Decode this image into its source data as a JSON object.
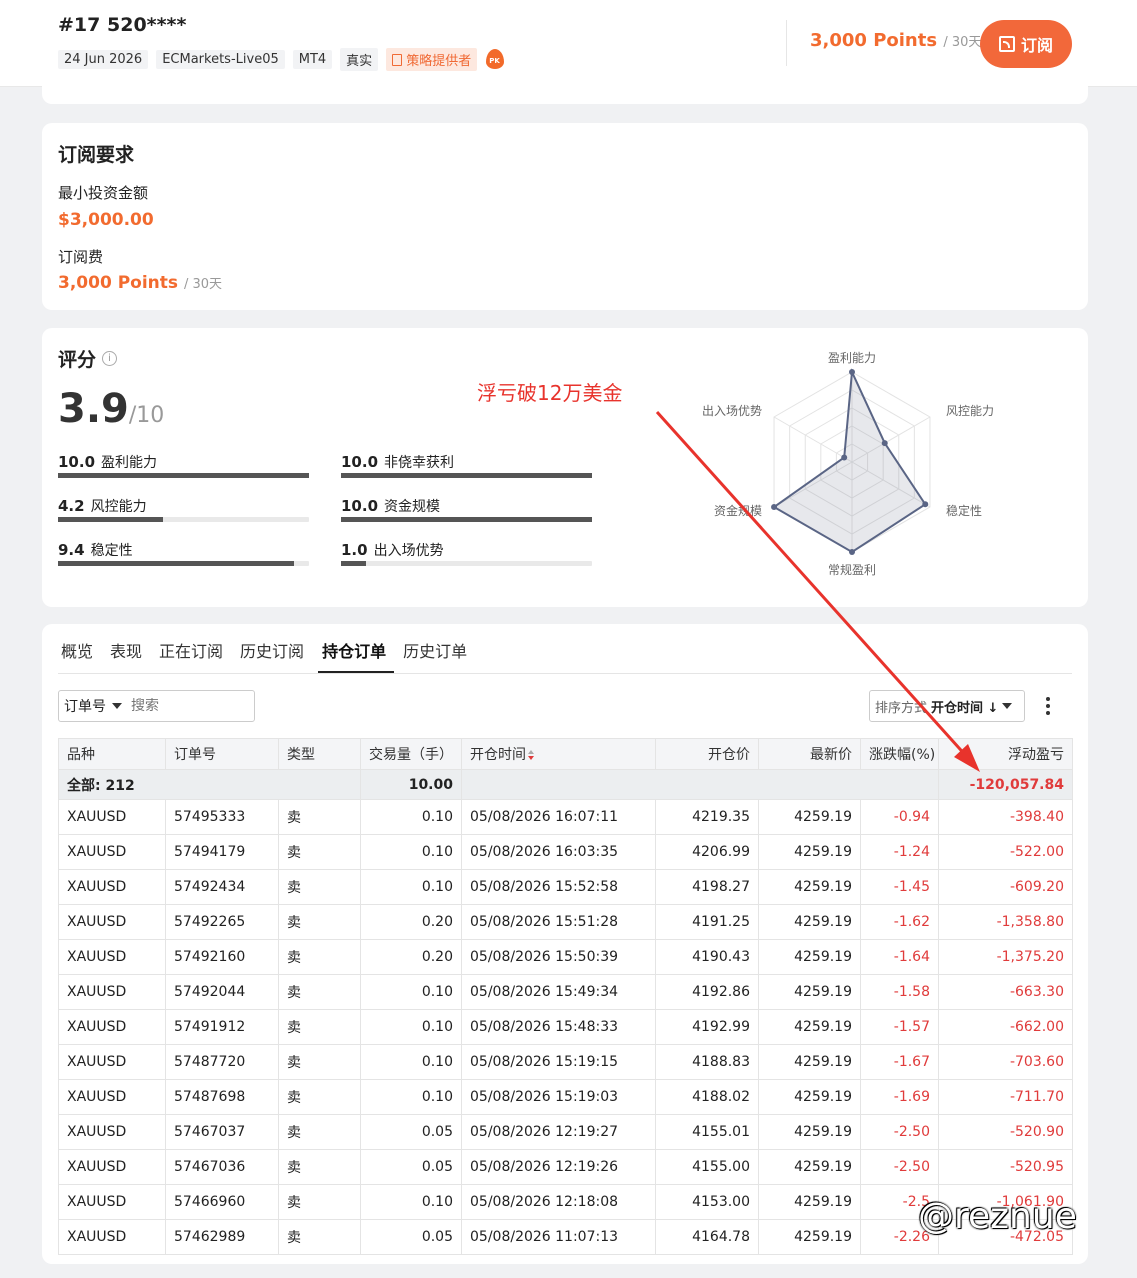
{
  "header": {
    "rank": "#17",
    "name": "520****",
    "tags": [
      "24 Jun 2026",
      "ECMarkets-Live05",
      "MT4",
      "真实"
    ],
    "provider_tag": "策略提供者",
    "pk_badge": "PK",
    "price": "3,000 Points",
    "price_period": "/ 30天",
    "subscribe_label": "订阅"
  },
  "requirements": {
    "title": "订阅要求",
    "min_invest_label": "最小投资金额",
    "min_invest_value": "$3,000.00",
    "fee_label": "订阅费",
    "fee_value": "3,000 Points",
    "fee_period": "/ 30天"
  },
  "score": {
    "title": "评分",
    "info_icon": "i",
    "value": "3.9",
    "max": "/10",
    "metrics": [
      {
        "value": "10.0",
        "label": "盈利能力",
        "fraction": 1.0
      },
      {
        "value": "10.0",
        "label": "非侥幸获利",
        "fraction": 1.0
      },
      {
        "value": "4.2",
        "label": "风控能力",
        "fraction": 0.42
      },
      {
        "value": "10.0",
        "label": "资金规模",
        "fraction": 1.0
      },
      {
        "value": "9.4",
        "label": "稳定性",
        "fraction": 0.94
      },
      {
        "value": "1.0",
        "label": "出入场优势",
        "fraction": 0.1
      }
    ],
    "radar_labels": [
      "盈利能力",
      "风控能力",
      "稳定性",
      "常规盈利",
      "资金规模",
      "出入场优势"
    ],
    "radar_values": [
      1.0,
      0.42,
      0.94,
      1.0,
      1.0,
      0.1
    ],
    "annotation": "浮亏破12万美金",
    "annotation_color": "#e8332c"
  },
  "tabs": [
    "概览",
    "表现",
    "正在订阅",
    "历史订阅",
    "持仓订单",
    "历史订单"
  ],
  "active_tab": "持仓订单",
  "filter": {
    "field": "订单号",
    "placeholder": "搜索"
  },
  "sort": {
    "label": "排序方式",
    "value": "开仓时间 ↓"
  },
  "table": {
    "headers": [
      "品种",
      "订单号",
      "类型",
      "交易量（手）",
      "开仓时间",
      "开仓价",
      "最新价",
      "涨跌幅(%)",
      "浮动盈亏"
    ],
    "total_label": "全部: 212",
    "total_volume": "10.00",
    "total_pnl": "-120,057.84",
    "rows": [
      [
        "XAUUSD",
        "57495333",
        "卖",
        "0.10",
        "05/08/2026 16:07:11",
        "4219.35",
        "4259.19",
        "-0.94",
        "-398.40"
      ],
      [
        "XAUUSD",
        "57494179",
        "卖",
        "0.10",
        "05/08/2026 16:03:35",
        "4206.99",
        "4259.19",
        "-1.24",
        "-522.00"
      ],
      [
        "XAUUSD",
        "57492434",
        "卖",
        "0.10",
        "05/08/2026 15:52:58",
        "4198.27",
        "4259.19",
        "-1.45",
        "-609.20"
      ],
      [
        "XAUUSD",
        "57492265",
        "卖",
        "0.20",
        "05/08/2026 15:51:28",
        "4191.25",
        "4259.19",
        "-1.62",
        "-1,358.80"
      ],
      [
        "XAUUSD",
        "57492160",
        "卖",
        "0.20",
        "05/08/2026 15:50:39",
        "4190.43",
        "4259.19",
        "-1.64",
        "-1,375.20"
      ],
      [
        "XAUUSD",
        "57492044",
        "卖",
        "0.10",
        "05/08/2026 15:49:34",
        "4192.86",
        "4259.19",
        "-1.58",
        "-663.30"
      ],
      [
        "XAUUSD",
        "57491912",
        "卖",
        "0.10",
        "05/08/2026 15:48:33",
        "4192.99",
        "4259.19",
        "-1.57",
        "-662.00"
      ],
      [
        "XAUUSD",
        "57487720",
        "卖",
        "0.10",
        "05/08/2026 15:19:15",
        "4188.83",
        "4259.19",
        "-1.67",
        "-703.60"
      ],
      [
        "XAUUSD",
        "57487698",
        "卖",
        "0.10",
        "05/08/2026 15:19:03",
        "4188.02",
        "4259.19",
        "-1.69",
        "-711.70"
      ],
      [
        "XAUUSD",
        "57467037",
        "卖",
        "0.05",
        "05/08/2026 12:19:27",
        "4155.01",
        "4259.19",
        "-2.50",
        "-520.90"
      ],
      [
        "XAUUSD",
        "57467036",
        "卖",
        "0.05",
        "05/08/2026 12:19:26",
        "4155.00",
        "4259.19",
        "-2.50",
        "-520.95"
      ],
      [
        "XAUUSD",
        "57466960",
        "卖",
        "0.10",
        "05/08/2026 12:18:08",
        "4153.00",
        "4259.19",
        "-2.5",
        "-1,061.90"
      ],
      [
        "XAUUSD",
        "57462989",
        "卖",
        "0.05",
        "05/08/2026 11:07:13",
        "4164.78",
        "4259.19",
        "-2.26",
        "-472.05"
      ]
    ]
  },
  "watermark": "@reznue",
  "colors": {
    "accent": "#f26b2f",
    "loss": "#e03b3b"
  }
}
